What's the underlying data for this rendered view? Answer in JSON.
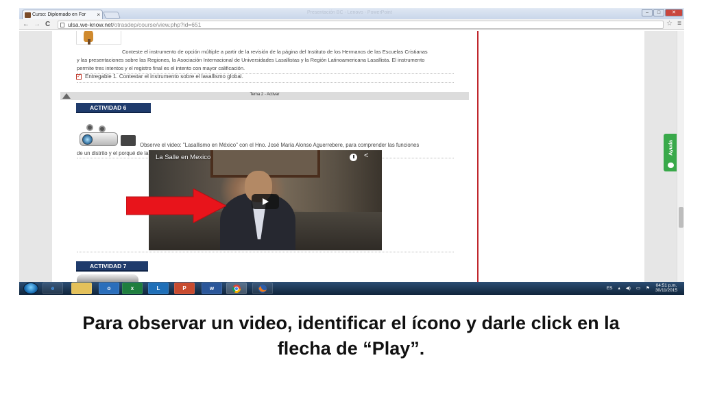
{
  "browser": {
    "tab_title": "Curso: Diplomado en For",
    "tab_close": "×",
    "window_title": "Presentación BC - Lenovo - PowerPoint",
    "url_host": "ulsa.we-know.net",
    "url_path": "/otrasdep/course/view.php?id=651",
    "back": "←",
    "forward": "→",
    "reload": "C",
    "star": "☆",
    "menu": "≡",
    "minimize": "–",
    "maximize": "□",
    "close": "✕"
  },
  "page": {
    "activity5": {
      "line1": "Conteste el instrumento de opción múltiple a partir de la revisión de la página del Instituto de los Hermanos de las Escuelas Cristianas",
      "line2": "y las presentaciones sobre las Regiones, la Asociación Internacional de Universidades Lasallistas y la Región Latinoamericana Lasallista. El instrumento",
      "line3": "permite tres intentos y el registro final es el intento con mayor calificación.",
      "deliverable": "Entregable 1. Contestar el instrumento sobre el lasallismo global."
    },
    "section": {
      "label": "Tema 2 - Activar"
    },
    "activity6": {
      "badge": "ACTIVIDAD 6",
      "line1": "Observe el video: \"Lasallismo en México\" con el Hno. José María Alonso Aguerrebere, para comprender las funciones",
      "line2": "de un distrito y el porqué de la división en nuestro país."
    },
    "video": {
      "title": "La Salle en Mexico"
    },
    "activity7": {
      "badge": "ACTIVIDAD 7"
    },
    "help_label": "Ayuda"
  },
  "taskbar": {
    "apps": [
      "e",
      "",
      "o",
      "x",
      "L",
      "P",
      "w",
      "",
      ""
    ],
    "lang": "ES",
    "time": "04:51 p.m.",
    "date": "30/11/2015"
  },
  "caption": {
    "line1": "Para observar un video, identificar el ícono y darle click en la",
    "line2": "flecha de “Play”."
  },
  "colors": {
    "activity_badge": "#1f3b6c",
    "arrow": "#e8141b",
    "help": "#39a94a",
    "divider": "#c0272d"
  }
}
